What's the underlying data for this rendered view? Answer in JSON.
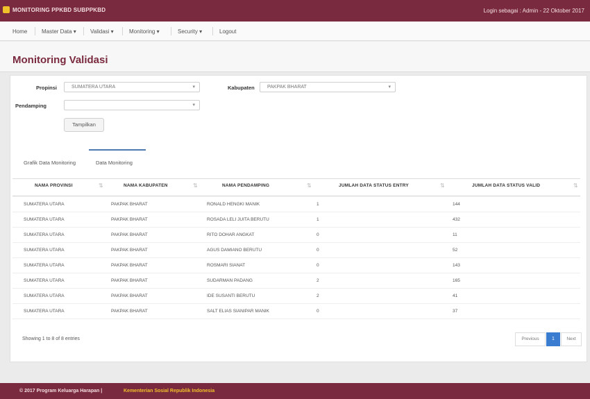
{
  "topbar": {
    "app_title": "MONITORING PPKBD SUBPPKBD",
    "login_info": "Login sebagai : Admin - 22 Oktober 2017"
  },
  "nav": [
    {
      "label": "Home"
    },
    {
      "label": "Master Data ▾"
    },
    {
      "label": "Validasi ▾"
    },
    {
      "label": "Monitoring ▾"
    },
    {
      "label": "Security ▾"
    },
    {
      "label": "Logout"
    }
  ],
  "page": {
    "title": "Monitoring Validasi"
  },
  "filters": {
    "provinsi_label": "Propinsi",
    "provinsi_value": "SUMATERA UTARA",
    "kabupaten_label": "Kabupaten",
    "kabupaten_value": "PAKPAK BHARAT",
    "pendamping_label": "Pendamping",
    "pendamping_value": "",
    "submit_label": "Tampilkan"
  },
  "tabs": [
    {
      "label": "Grafik Data Monitoring"
    },
    {
      "label": "Data Monitoring"
    }
  ],
  "table": {
    "headers": [
      "NAMA PROVINSI",
      "NAMA KABUPATEN",
      "NAMA PENDAMPING",
      "JUMLAH DATA STATUS ENTRY",
      "JUMLAH DATA STATUS VALID"
    ],
    "rows": [
      [
        "SUMATERA UTARA",
        "PAKPAK BHARAT",
        "RONALD HENGKI MANIK",
        "1",
        "144"
      ],
      [
        "SUMATERA UTARA",
        "PAKPAK BHARAT",
        "ROSADA LELI JUITA BERUTU",
        "1",
        "432"
      ],
      [
        "SUMATERA UTARA",
        "PAKPAK BHARAT",
        "RITO DOHAR ANGKAT",
        "0",
        "11"
      ],
      [
        "SUMATERA UTARA",
        "PAKPAK BHARAT",
        "AGUS DAMIANO BERUTU",
        "0",
        "52"
      ],
      [
        "SUMATERA UTARA",
        "PAKPAK BHARAT",
        "ROSMARI SIANAT",
        "0",
        "143"
      ],
      [
        "SUMATERA UTARA",
        "PAKPAK BHARAT",
        "SUDARMAN PADANG",
        "2",
        "165"
      ],
      [
        "SUMATERA UTARA",
        "PAKPAK BHARAT",
        "IDE SUSANTI BERUTU",
        "2",
        "41"
      ],
      [
        "SUMATERA UTARA",
        "PAKPAK BHARAT",
        "SALT ELIAS SIANIPAR MANIK",
        "0",
        "37"
      ]
    ]
  },
  "pagination": {
    "info": "Showing 1 to 8 of 8 entries",
    "prev": "Previous",
    "page": "1",
    "next": "Next"
  },
  "footer": {
    "copyright": "© 2017 Program Keluarga Harapan |",
    "org": "Kementerian Sosial Republik Indonesia"
  },
  "colors": {
    "brand": "#7a2a3e",
    "accent": "#3a7ccf",
    "footer_link": "#f0c12a"
  }
}
